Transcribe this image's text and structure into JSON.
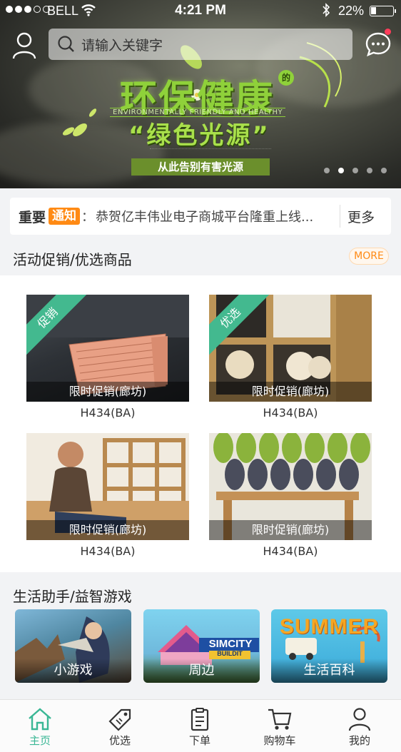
{
  "status_bar": {
    "carrier": "BELL",
    "time": "4:21 PM",
    "battery": "22%"
  },
  "search": {
    "placeholder": "请输入关键字"
  },
  "banner": {
    "headline": "环保健康",
    "headline_suffix": "的",
    "english": "ENVIRONMENTALLY FRIENDLY AND HEALTHY",
    "subtitle": "“绿色光源”",
    "tagline": "从此告别有害光源"
  },
  "notice": {
    "label": "重要",
    "tag": "通知",
    "colon": "：",
    "text": "恭贺亿丰伟业电子商城平台隆重上线...",
    "more": "更多"
  },
  "promo_section": {
    "title": "活动促销/优选商品",
    "more": "MORE",
    "products": [
      {
        "badge": "促销",
        "caption": "限时促销(廊坊)",
        "name": "H434(BA)"
      },
      {
        "badge": "优选",
        "caption": "限时促销(廊坊)",
        "name": "H434(BA)"
      },
      {
        "badge": "",
        "caption": "限时促销(廊坊)",
        "name": "H434(BA)"
      },
      {
        "badge": "",
        "caption": "限时促销(廊坊)",
        "name": "H434(BA)"
      }
    ]
  },
  "life_section": {
    "title": "生活助手/益智游戏",
    "tiles": [
      {
        "label": "小游戏"
      },
      {
        "label": "周边",
        "art": "SIMCITY",
        "art2": "BUILDIT"
      },
      {
        "label": "生活百科",
        "art": "SUMMER"
      }
    ]
  },
  "tabbar": [
    {
      "label": "主页",
      "icon": "home-icon",
      "active": true
    },
    {
      "label": "优选",
      "icon": "tag-icon",
      "active": false
    },
    {
      "label": "下单",
      "icon": "clipboard-icon",
      "active": false
    },
    {
      "label": "购物车",
      "icon": "cart-icon",
      "active": false
    },
    {
      "label": "我的",
      "icon": "user-icon",
      "active": false
    }
  ],
  "colors": {
    "accent": "#3ab795",
    "orange": "#ff8a14",
    "ribbon": "#43b98f"
  }
}
